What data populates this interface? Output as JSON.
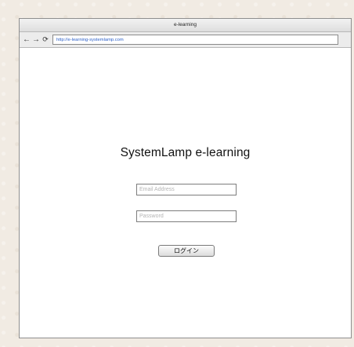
{
  "window": {
    "title": "e-learning"
  },
  "toolbar": {
    "back_icon": "←",
    "forward_icon": "→",
    "reload_icon": "⟳",
    "url": "http://e-learning-systemlamp.com"
  },
  "page": {
    "title": "SystemLamp e-learning",
    "email_placeholder": "Email Address",
    "password_placeholder": "Password",
    "login_label": "ログイン"
  },
  "icons": {
    "back": "back-arrow-icon",
    "forward": "forward-arrow-icon",
    "reload": "reload-icon"
  },
  "colors": {
    "url_text": "#2d61c9",
    "placeholder_text": "#b4b4b4",
    "background": "#f1ebe3"
  }
}
